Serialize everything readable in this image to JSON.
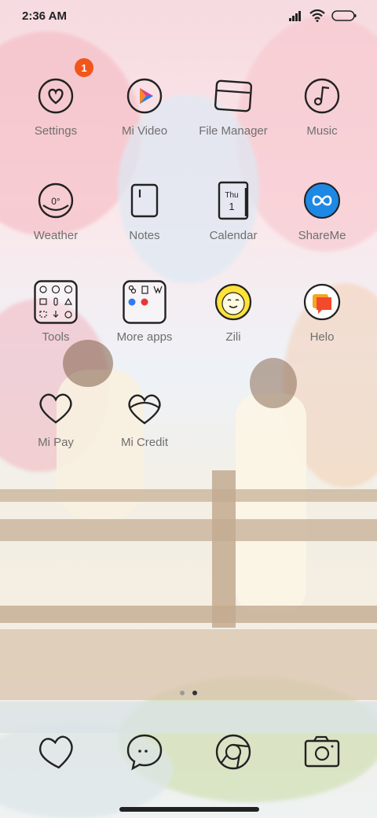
{
  "status": {
    "time": "2:36 AM",
    "icons": [
      "signal-icon",
      "wifi-icon",
      "battery-icon"
    ]
  },
  "apps": [
    {
      "label": "Settings",
      "icon": "settings-icon",
      "badge": "1"
    },
    {
      "label": "Mi Video",
      "icon": "mi-video-icon"
    },
    {
      "label": "File Manager",
      "icon": "file-manager-icon"
    },
    {
      "label": "Music",
      "icon": "music-icon"
    },
    {
      "label": "Weather",
      "icon": "weather-icon",
      "temp": "0°"
    },
    {
      "label": "Notes",
      "icon": "notes-icon"
    },
    {
      "label": "Calendar",
      "icon": "calendar-icon",
      "day": "Thu",
      "date": "1"
    },
    {
      "label": "ShareMe",
      "icon": "shareme-icon"
    },
    {
      "label": "Tools",
      "icon": "tools-folder-icon"
    },
    {
      "label": "More apps",
      "icon": "more-apps-folder-icon"
    },
    {
      "label": "Zili",
      "icon": "zili-icon"
    },
    {
      "label": "Helo",
      "icon": "helo-icon"
    },
    {
      "label": "Mi Pay",
      "icon": "mi-pay-icon"
    },
    {
      "label": "Mi Credit",
      "icon": "mi-credit-icon"
    }
  ],
  "pages": {
    "count": 2,
    "active": 2
  },
  "dock": [
    {
      "icon": "phone-icon"
    },
    {
      "icon": "messages-icon"
    },
    {
      "icon": "browser-icon"
    },
    {
      "icon": "camera-icon"
    }
  ],
  "colors": {
    "badge": "#f2561b",
    "label": "#6f6f6f",
    "shareme": "#1e88e5",
    "helo": "#f24a2a",
    "zili": "#ffe23a"
  }
}
